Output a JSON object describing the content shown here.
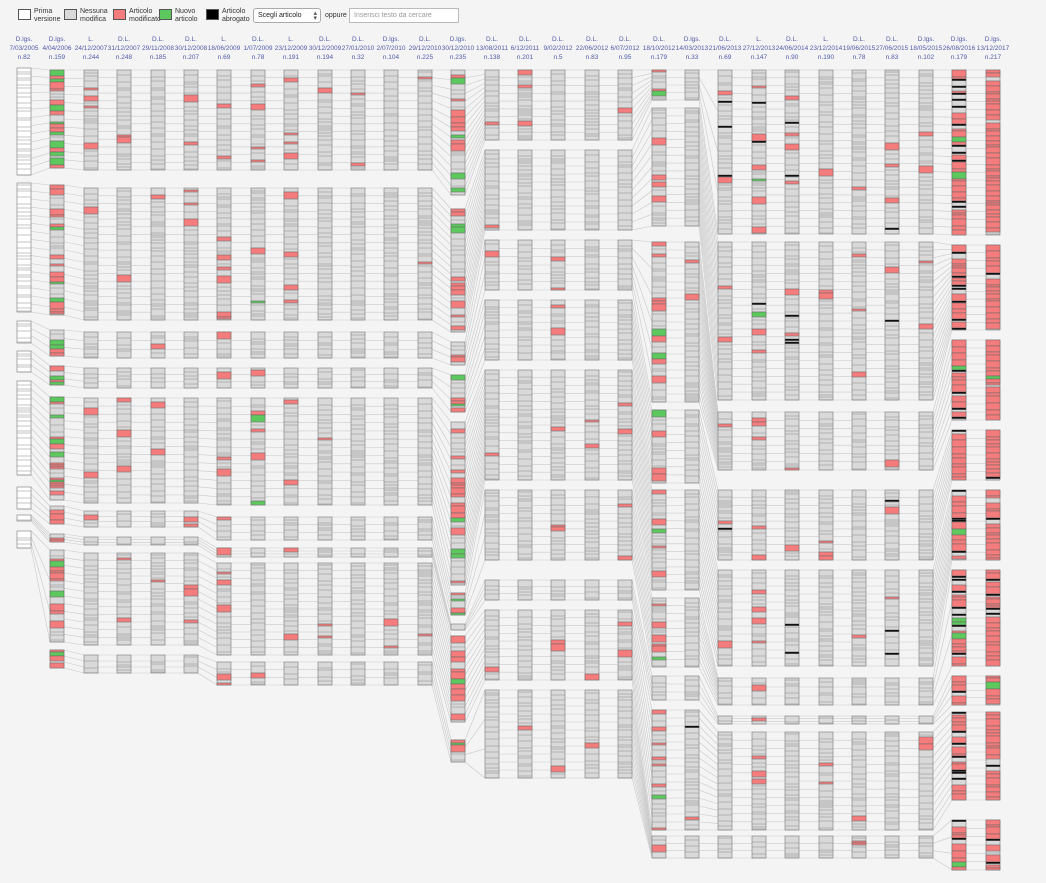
{
  "legend": [
    {
      "key": "prima",
      "label": "Prima\nversione",
      "color": "#ffffff"
    },
    {
      "key": "nessuna",
      "label": "Nessuna\nmodifica",
      "color": "#d9d9d9"
    },
    {
      "key": "modificato",
      "label": "Articolo\nmodificato",
      "color": "#f47c7c"
    },
    {
      "key": "nuovo",
      "label": "Nuovo\narticolo",
      "color": "#5dc85d"
    },
    {
      "key": "abrogato",
      "label": "Articolo\nabrogato",
      "color": "#000000"
    }
  ],
  "controls": {
    "select_label": "Scegli articolo",
    "or_label": "oppure",
    "search_placeholder": "Inserisci testo da cercare"
  },
  "versions": [
    {
      "type": "D.lgs.",
      "date": "7/03/2005",
      "num": "n.82"
    },
    {
      "type": "D.lgs.",
      "date": "4/04/2006",
      "num": "n.159"
    },
    {
      "type": "L.",
      "date": "24/12/2007",
      "num": "n.244"
    },
    {
      "type": "D.L.",
      "date": "31/12/2007",
      "num": "n.248"
    },
    {
      "type": "D.L.",
      "date": "29/11/2008",
      "num": "n.185"
    },
    {
      "type": "D.L.",
      "date": "30/12/2008",
      "num": "n.207"
    },
    {
      "type": "L.",
      "date": "18/06/2009",
      "num": "n.69"
    },
    {
      "type": "D.L.",
      "date": "1/07/2009",
      "num": "n.78"
    },
    {
      "type": "L.",
      "date": "23/12/2009",
      "num": "n.191"
    },
    {
      "type": "D.L.",
      "date": "30/12/2009",
      "num": "n.194"
    },
    {
      "type": "D.L.",
      "date": "27/01/2010",
      "num": "n.32"
    },
    {
      "type": "D.lgs.",
      "date": "2/07/2010",
      "num": "n.104"
    },
    {
      "type": "D.L.",
      "date": "29/12/2010",
      "num": "n.225"
    },
    {
      "type": "D.lgs.",
      "date": "30/12/2010",
      "num": "n.235"
    },
    {
      "type": "D.L.",
      "date": "13/08/2011",
      "num": "n.138"
    },
    {
      "type": "D.L.",
      "date": "6/12/2011",
      "num": "n.201"
    },
    {
      "type": "D.L.",
      "date": "9/02/2012",
      "num": "n.5"
    },
    {
      "type": "D.L.",
      "date": "22/06/2012",
      "num": "n.83"
    },
    {
      "type": "D.L.",
      "date": "6/07/2012",
      "num": "n.95"
    },
    {
      "type": "D.L.",
      "date": "18/10/2012",
      "num": "n.179"
    },
    {
      "type": "D.lgs.",
      "date": "14/03/2013",
      "num": "n.33"
    },
    {
      "type": "D.L.",
      "date": "21/06/2013",
      "num": "n.69"
    },
    {
      "type": "L.",
      "date": "27/12/2013",
      "num": "n.147"
    },
    {
      "type": "D.L.",
      "date": "24/06/2014",
      "num": "n.90"
    },
    {
      "type": "L.",
      "date": "23/12/2014",
      "num": "n.190"
    },
    {
      "type": "D.L.",
      "date": "19/06/2015",
      "num": "n.78"
    },
    {
      "type": "D.L.",
      "date": "27/06/2015",
      "num": "n.83"
    },
    {
      "type": "D.lgs.",
      "date": "18/05/2015",
      "num": "n.102"
    },
    {
      "type": "D.lgs.",
      "date": "26/08/2016",
      "num": "n.179"
    },
    {
      "type": "D.lgs.",
      "date": "13/12/2017",
      "num": "n.217"
    }
  ]
}
